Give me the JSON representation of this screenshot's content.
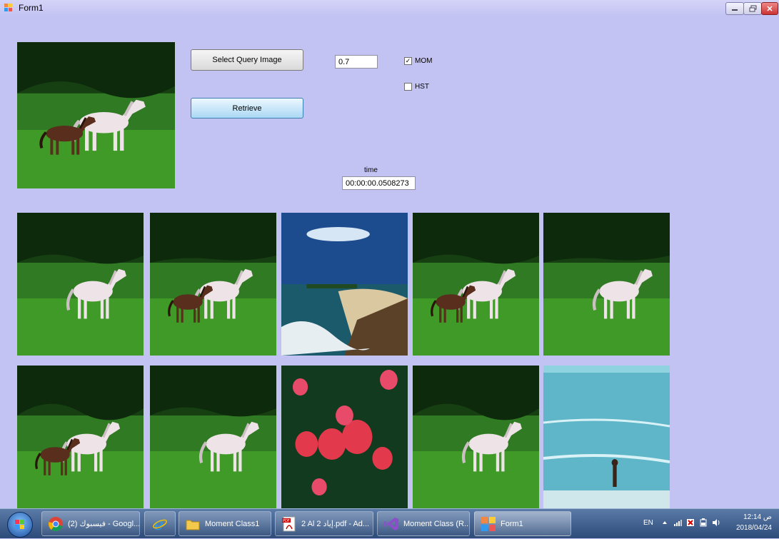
{
  "window": {
    "title": "Form1"
  },
  "controls": {
    "select_button": "Select Query Image",
    "retrieve_button": "Retrieve",
    "threshold_value": "0.7",
    "mom_label": "MOM",
    "mom_checked": true,
    "hst_label": "HST",
    "hst_checked": false,
    "time_label": "time",
    "time_value": "00:00:00.0508273"
  },
  "query_image": {
    "scene": "horses"
  },
  "results": [
    {
      "scene": "horses"
    },
    {
      "scene": "horses"
    },
    {
      "scene": "seaside"
    },
    {
      "scene": "horses"
    },
    {
      "scene": "horses"
    },
    {
      "scene": "horses"
    },
    {
      "scene": "horses"
    },
    {
      "scene": "flowers"
    },
    {
      "scene": "horses"
    },
    {
      "scene": "beach"
    }
  ],
  "taskbar": {
    "items": [
      {
        "label": "(2) فيسبوك - Googl...",
        "icon": "chrome-icon"
      },
      {
        "label": "",
        "icon": "internet-explorer-icon"
      },
      {
        "label": "Moment Class1",
        "icon": "folder-icon"
      },
      {
        "label": "2 Al 2 إياد.pdf - Ad...",
        "icon": "pdf-icon"
      },
      {
        "label": "Moment Class (R...",
        "icon": "visual-studio-icon"
      },
      {
        "label": "Form1",
        "icon": "form-app-icon"
      }
    ],
    "tray": {
      "language": "EN",
      "time": "12:14 ص",
      "date": "2018/04/24"
    }
  },
  "colors": {
    "form_background": "#c3c3f3",
    "retrieve_button": "#aad8f4"
  }
}
